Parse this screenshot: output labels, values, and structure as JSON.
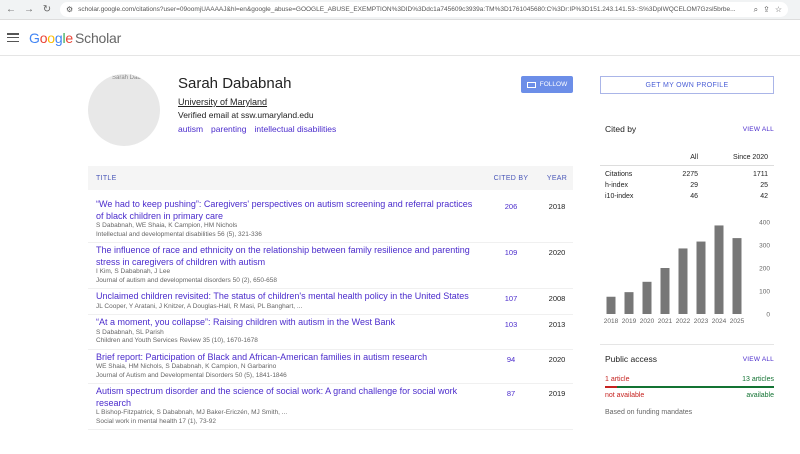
{
  "browser": {
    "url": "scholar.google.com/citations?user=09oomjUAAAAJ&hl=en&google_abuse=GOOGLE_ABUSE_EXEMPTION%3DID%3Ddc1a745609c3939a:TM%3D1761045680:C%3Dr:IP%3D151.243.141.53-:S%3DpIWQCELOM7Gzsl5brbe..."
  },
  "header": {
    "logo_google": [
      "G",
      "o",
      "o",
      "g",
      "l",
      "e"
    ],
    "logo_scholar": "Scholar"
  },
  "profile": {
    "avatar_alt": "Sarah Dab",
    "name": "Sarah Dababnah",
    "affiliation": "University of Maryland",
    "email": "Verified email at ssw.umaryland.edu",
    "interests": [
      "autism",
      "parenting",
      "intellectual disabilities"
    ],
    "follow_label": "FOLLOW"
  },
  "table": {
    "col_title": "TITLE",
    "col_cited": "CITED BY",
    "col_year": "YEAR",
    "rows": [
      {
        "title": "“We had to keep pushing”: Caregivers' perspectives on autism screening and referral practices of black children in primary care",
        "authors": "S Dababnah, WE Shaia, K Campion, HM Nichols",
        "venue": "Intellectual and developmental disabilities 56 (5), 321-336",
        "cited": "206",
        "year": "2018"
      },
      {
        "title": "The influence of race and ethnicity on the relationship between family resilience and parenting stress in caregivers of children with autism",
        "authors": "I Kim, S Dababnah, J Lee",
        "venue": "Journal of autism and developmental disorders 50 (2), 650-658",
        "cited": "109",
        "year": "2020"
      },
      {
        "title": "Unclaimed children revisited: The status of children's mental health policy in the United States",
        "authors": "JL Cooper, Y Aratani, J Knitzer, A Douglas-Hall, R Masi, PL Banghart, ...",
        "venue": "",
        "cited": "107",
        "year": "2008"
      },
      {
        "title": "“At a moment, you collapse”: Raising children with autism in the West Bank",
        "authors": "S Dababnah, SL Parish",
        "venue": "Children and Youth Services Review 35 (10), 1670-1678",
        "cited": "103",
        "year": "2013"
      },
      {
        "title": "Brief report: Participation of Black and African-American families in autism research",
        "authors": "WE Shaia, HM Nichols, S Dababnah, K Campion, N Garbarino",
        "venue": "Journal of Autism and Developmental Disorders 50 (5), 1841-1846",
        "cited": "94",
        "year": "2020"
      },
      {
        "title": "Autism spectrum disorder and the science of social work: A grand challenge for social work research",
        "authors": "L Bishop-Fitzpatrick, S Dababnah, MJ Baker-Ericzén, MJ Smith, ...",
        "venue": "Social work in mental health 17 (1), 73-92",
        "cited": "87",
        "year": "2019"
      }
    ]
  },
  "right": {
    "get_profile_label": "GET MY OWN PROFILE",
    "cited_by_label": "Cited by",
    "view_all_label": "VIEW ALL",
    "col_all": "All",
    "col_since": "Since 2020",
    "metrics": [
      {
        "label": "Citations",
        "all": "2275",
        "since": "1711"
      },
      {
        "label": "h-index",
        "all": "29",
        "since": "25"
      },
      {
        "label": "i10-index",
        "all": "46",
        "since": "42"
      }
    ],
    "public_access_label": "Public access",
    "access_view_all_label": "VIEW ALL",
    "not_available_count": "1 article",
    "available_count": "13 articles",
    "not_available_label": "not available",
    "available_label": "available",
    "mandates_label": "Based on funding mandates"
  },
  "chart_data": {
    "type": "bar",
    "categories": [
      "2018",
      "2019",
      "2020",
      "2021",
      "2022",
      "2023",
      "2024",
      "2025"
    ],
    "values": [
      75,
      95,
      140,
      200,
      285,
      315,
      385,
      330
    ],
    "ylim": [
      0,
      400
    ],
    "yticks": [
      0,
      100,
      200,
      300,
      400
    ],
    "color": "#777777"
  }
}
